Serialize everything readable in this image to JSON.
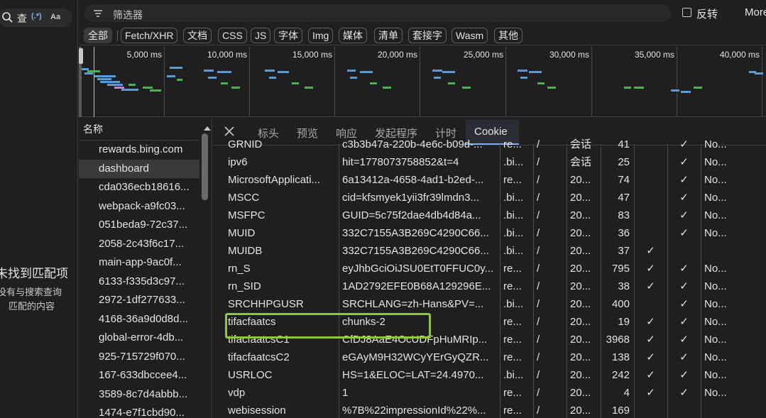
{
  "search_panel": {
    "query_glyph": "查",
    "regex_toggle": "(.*)",
    "case_toggle": "Aa",
    "no_match_title": "未找到匹配项",
    "no_match_line1": "没有与搜索查询",
    "no_match_line2": "匹配的内容"
  },
  "filter": {
    "placeholder": "筛选器",
    "invert_label": "反转",
    "more_label": "More"
  },
  "type_filters": [
    "全部",
    "Fetch/XHR",
    "文档",
    "CSS",
    "JS",
    "字体",
    "Img",
    "媒体",
    "清单",
    "套接字",
    "Wasm",
    "其他"
  ],
  "overview": {
    "ticks": [
      "5,000 ms",
      "10,000 ms",
      "15,000 ms",
      "20,000 ms",
      "25,000 ms",
      "30,000 ms",
      "35,000 ms",
      "40,000 ms"
    ]
  },
  "requests": {
    "header": "名称",
    "rows": [
      "rewards.bing.com",
      "dashboard",
      "cda036ecb18616...",
      "webpack-a9fc03...",
      "051beda9-72c37...",
      "2058-2c43f6c17...",
      "main-app-9ac0f...",
      "6133-f335d3c97...",
      "2972-1df277633...",
      "4168-36a9d0d8d...",
      "global-error-4db...",
      "925-715729f070...",
      "167-633dbccee4...",
      "3589-8c7d4abbb...",
      "1474-e7f1cbd90..."
    ],
    "selected": "dashboard"
  },
  "detail_tabs": [
    "标头",
    "预览",
    "响应",
    "发起程序",
    "计时",
    "Cookie"
  ],
  "active_tab": "Cookie",
  "check_mark": "✓",
  "cookies": [
    {
      "name": "GRNID",
      "value": "c3b3b47a-220b-4e6c-b09d-...",
      "domain": "re...",
      "path": "/",
      "expires": "会话",
      "size": "41",
      "httponly": "",
      "secure": "✓",
      "samesite": "No..."
    },
    {
      "name": "ipv6",
      "value": "hit=1778073758852&t=4",
      "domain": ".bi...",
      "path": "/",
      "expires": "会话",
      "size": "25",
      "httponly": "",
      "secure": "✓",
      "samesite": "No..."
    },
    {
      "name": "MicrosoftApplicati...",
      "value": "6a13412a-4658-4ad1-b2ed-...",
      "domain": "re...",
      "path": "/",
      "expires": "20...",
      "size": "74",
      "httponly": "",
      "secure": "✓",
      "samesite": "No..."
    },
    {
      "name": "MSCC",
      "value": "cid=kfsmyek1yii3fr39lmdn3...",
      "domain": ".bi...",
      "path": "/",
      "expires": "20...",
      "size": "47",
      "httponly": "",
      "secure": "✓",
      "samesite": "No..."
    },
    {
      "name": "MSFPC",
      "value": "GUID=5c75f2dae4db4d84a...",
      "domain": ".bi...",
      "path": "/",
      "expires": "20...",
      "size": "83",
      "httponly": "",
      "secure": "✓",
      "samesite": "No..."
    },
    {
      "name": "MUID",
      "value": "332C7155A3B269C4290C66...",
      "domain": ".bi...",
      "path": "/",
      "expires": "20...",
      "size": "36",
      "httponly": "",
      "secure": "✓",
      "samesite": "No..."
    },
    {
      "name": "MUIDB",
      "value": "332C7155A3B269C4290C66...",
      "domain": ".bi...",
      "path": "/",
      "expires": "20...",
      "size": "37",
      "httponly": "✓",
      "secure": "",
      "samesite": ""
    },
    {
      "name": "rn_S",
      "value": "eyJhbGciOiJSU0EtT0FFUC0y...",
      "domain": "re...",
      "path": "/",
      "expires": "20...",
      "size": "795",
      "httponly": "✓",
      "secure": "✓",
      "samesite": "No..."
    },
    {
      "name": "rn_SID",
      "value": "1AD2792EFE0B68A129296E...",
      "domain": "re...",
      "path": "/",
      "expires": "20...",
      "size": "38",
      "httponly": "✓",
      "secure": "✓",
      "samesite": "No..."
    },
    {
      "name": "SRCHHPGUSR",
      "value": "SRCHLANG=zh-Hans&PV=...",
      "domain": ".bi...",
      "path": "/",
      "expires": "20...",
      "size": "400",
      "httponly": "",
      "secure": "✓",
      "samesite": "No..."
    },
    {
      "name": "tifacfaatcs",
      "value": "chunks-2",
      "domain": "re...",
      "path": "/",
      "expires": "20...",
      "size": "19",
      "httponly": "✓",
      "secure": "✓",
      "samesite": "No..."
    },
    {
      "name": "tifacfaatcsC1",
      "value": "CfDJ8AaE4OcUDFpHuMRIp...",
      "domain": "re...",
      "path": "/",
      "expires": "20...",
      "size": "3968",
      "httponly": "✓",
      "secure": "✓",
      "samesite": "No..."
    },
    {
      "name": "tifacfaatcsC2",
      "value": "eGAyM9H32WCyYErGyQZR...",
      "domain": "re...",
      "path": "/",
      "expires": "20...",
      "size": "138",
      "httponly": "✓",
      "secure": "✓",
      "samesite": "No..."
    },
    {
      "name": "USRLOC",
      "value": "HS=1&ELOC=LAT=24.4970...",
      "domain": ".bi...",
      "path": "/",
      "expires": "20...",
      "size": "242",
      "httponly": "✓",
      "secure": "✓",
      "samesite": "No..."
    },
    {
      "name": "vdp",
      "value": "1",
      "domain": "re...",
      "path": "/",
      "expires": "20...",
      "size": "4",
      "httponly": "✓",
      "secure": "✓",
      "samesite": "No..."
    },
    {
      "name": "webisession",
      "value": "%7B%22impressionId%22%...",
      "domain": "re...",
      "path": "/",
      "expires": "20...",
      "size": "169",
      "httponly": "",
      "secure": "",
      "samesite": ""
    }
  ],
  "highlighted_cookie": "tifacfaatcs",
  "colors": {
    "accent": "#7cacf8",
    "highlight": "#8dc63f",
    "background": "#1f1f1f"
  }
}
